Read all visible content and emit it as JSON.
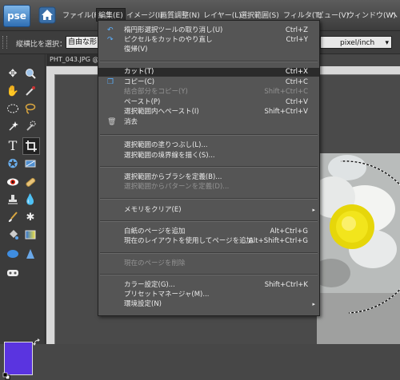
{
  "app": {
    "logo_text": "pse"
  },
  "menubar": {
    "items": [
      {
        "label": "ファイル(F)"
      },
      {
        "label": "編集(E)"
      },
      {
        "label": "イメージ(I)"
      },
      {
        "label": "画質調整(N)"
      },
      {
        "label": "レイヤー(L)"
      },
      {
        "label": "選択範囲(S)"
      },
      {
        "label": "フィルタ(T)"
      },
      {
        "label": "ビュー(V)"
      },
      {
        "label": "ウィンドウ(W)"
      },
      {
        "label": "ヘ"
      }
    ]
  },
  "options_bar": {
    "label": "縦横比を選択：",
    "ratio_value": "自由な形",
    "unit_value": "pixel/inch"
  },
  "document": {
    "tab_label": "PHT_043.JPG @"
  },
  "colors": {
    "foreground": "#5a34e0",
    "background": "#ffffff"
  },
  "edit_menu": {
    "items": [
      {
        "label": "楕円形選択ツールの取り消し(U)",
        "shortcut": "Ctrl+Z",
        "icon": "undo-icon"
      },
      {
        "label": "ピクセルをカットのやり直し",
        "shortcut": "Ctrl+Y",
        "icon": "redo-icon"
      },
      {
        "label": "復帰(V)",
        "shortcut": ""
      },
      {
        "label": "カット(T)",
        "shortcut": "Ctrl+X",
        "highlight": true
      },
      {
        "label": "コピー(C)",
        "shortcut": "Ctrl+C",
        "icon": "copy-icon"
      },
      {
        "label": "結合部分をコピー(Y)",
        "shortcut": "Shift+Ctrl+C",
        "disabled": true
      },
      {
        "label": "ペースト(P)",
        "shortcut": "Ctrl+V"
      },
      {
        "label": "選択範囲内へペースト(I)",
        "shortcut": "Shift+Ctrl+V"
      },
      {
        "label": "消去",
        "shortcut": "",
        "icon": "trash-icon"
      },
      {
        "label": "選択範囲の塗りつぶし(L)...",
        "shortcut": ""
      },
      {
        "label": "選択範囲の境界線を描く(S)...",
        "shortcut": ""
      },
      {
        "label": "選択範囲からブラシを定義(B)...",
        "shortcut": ""
      },
      {
        "label": "選択範囲からパターンを定義(D)...",
        "shortcut": "",
        "disabled": true
      },
      {
        "label": "メモリをクリア(E)",
        "shortcut": "",
        "submenu": true
      },
      {
        "label": "白紙のページを追加",
        "shortcut": "Alt+Ctrl+G"
      },
      {
        "label": "現在のレイアウトを使用してページを追加",
        "shortcut": "Alt+Shift+Ctrl+G"
      },
      {
        "label": "現在のページを削除",
        "shortcut": "",
        "disabled": true
      },
      {
        "label": "カラー設定(G)...",
        "shortcut": "Shift+Ctrl+K"
      },
      {
        "label": "プリセットマネージャ(M)...",
        "shortcut": ""
      },
      {
        "label": "環境設定(N)",
        "shortcut": "",
        "submenu": true
      }
    ],
    "submenu_arrow": "▸"
  }
}
